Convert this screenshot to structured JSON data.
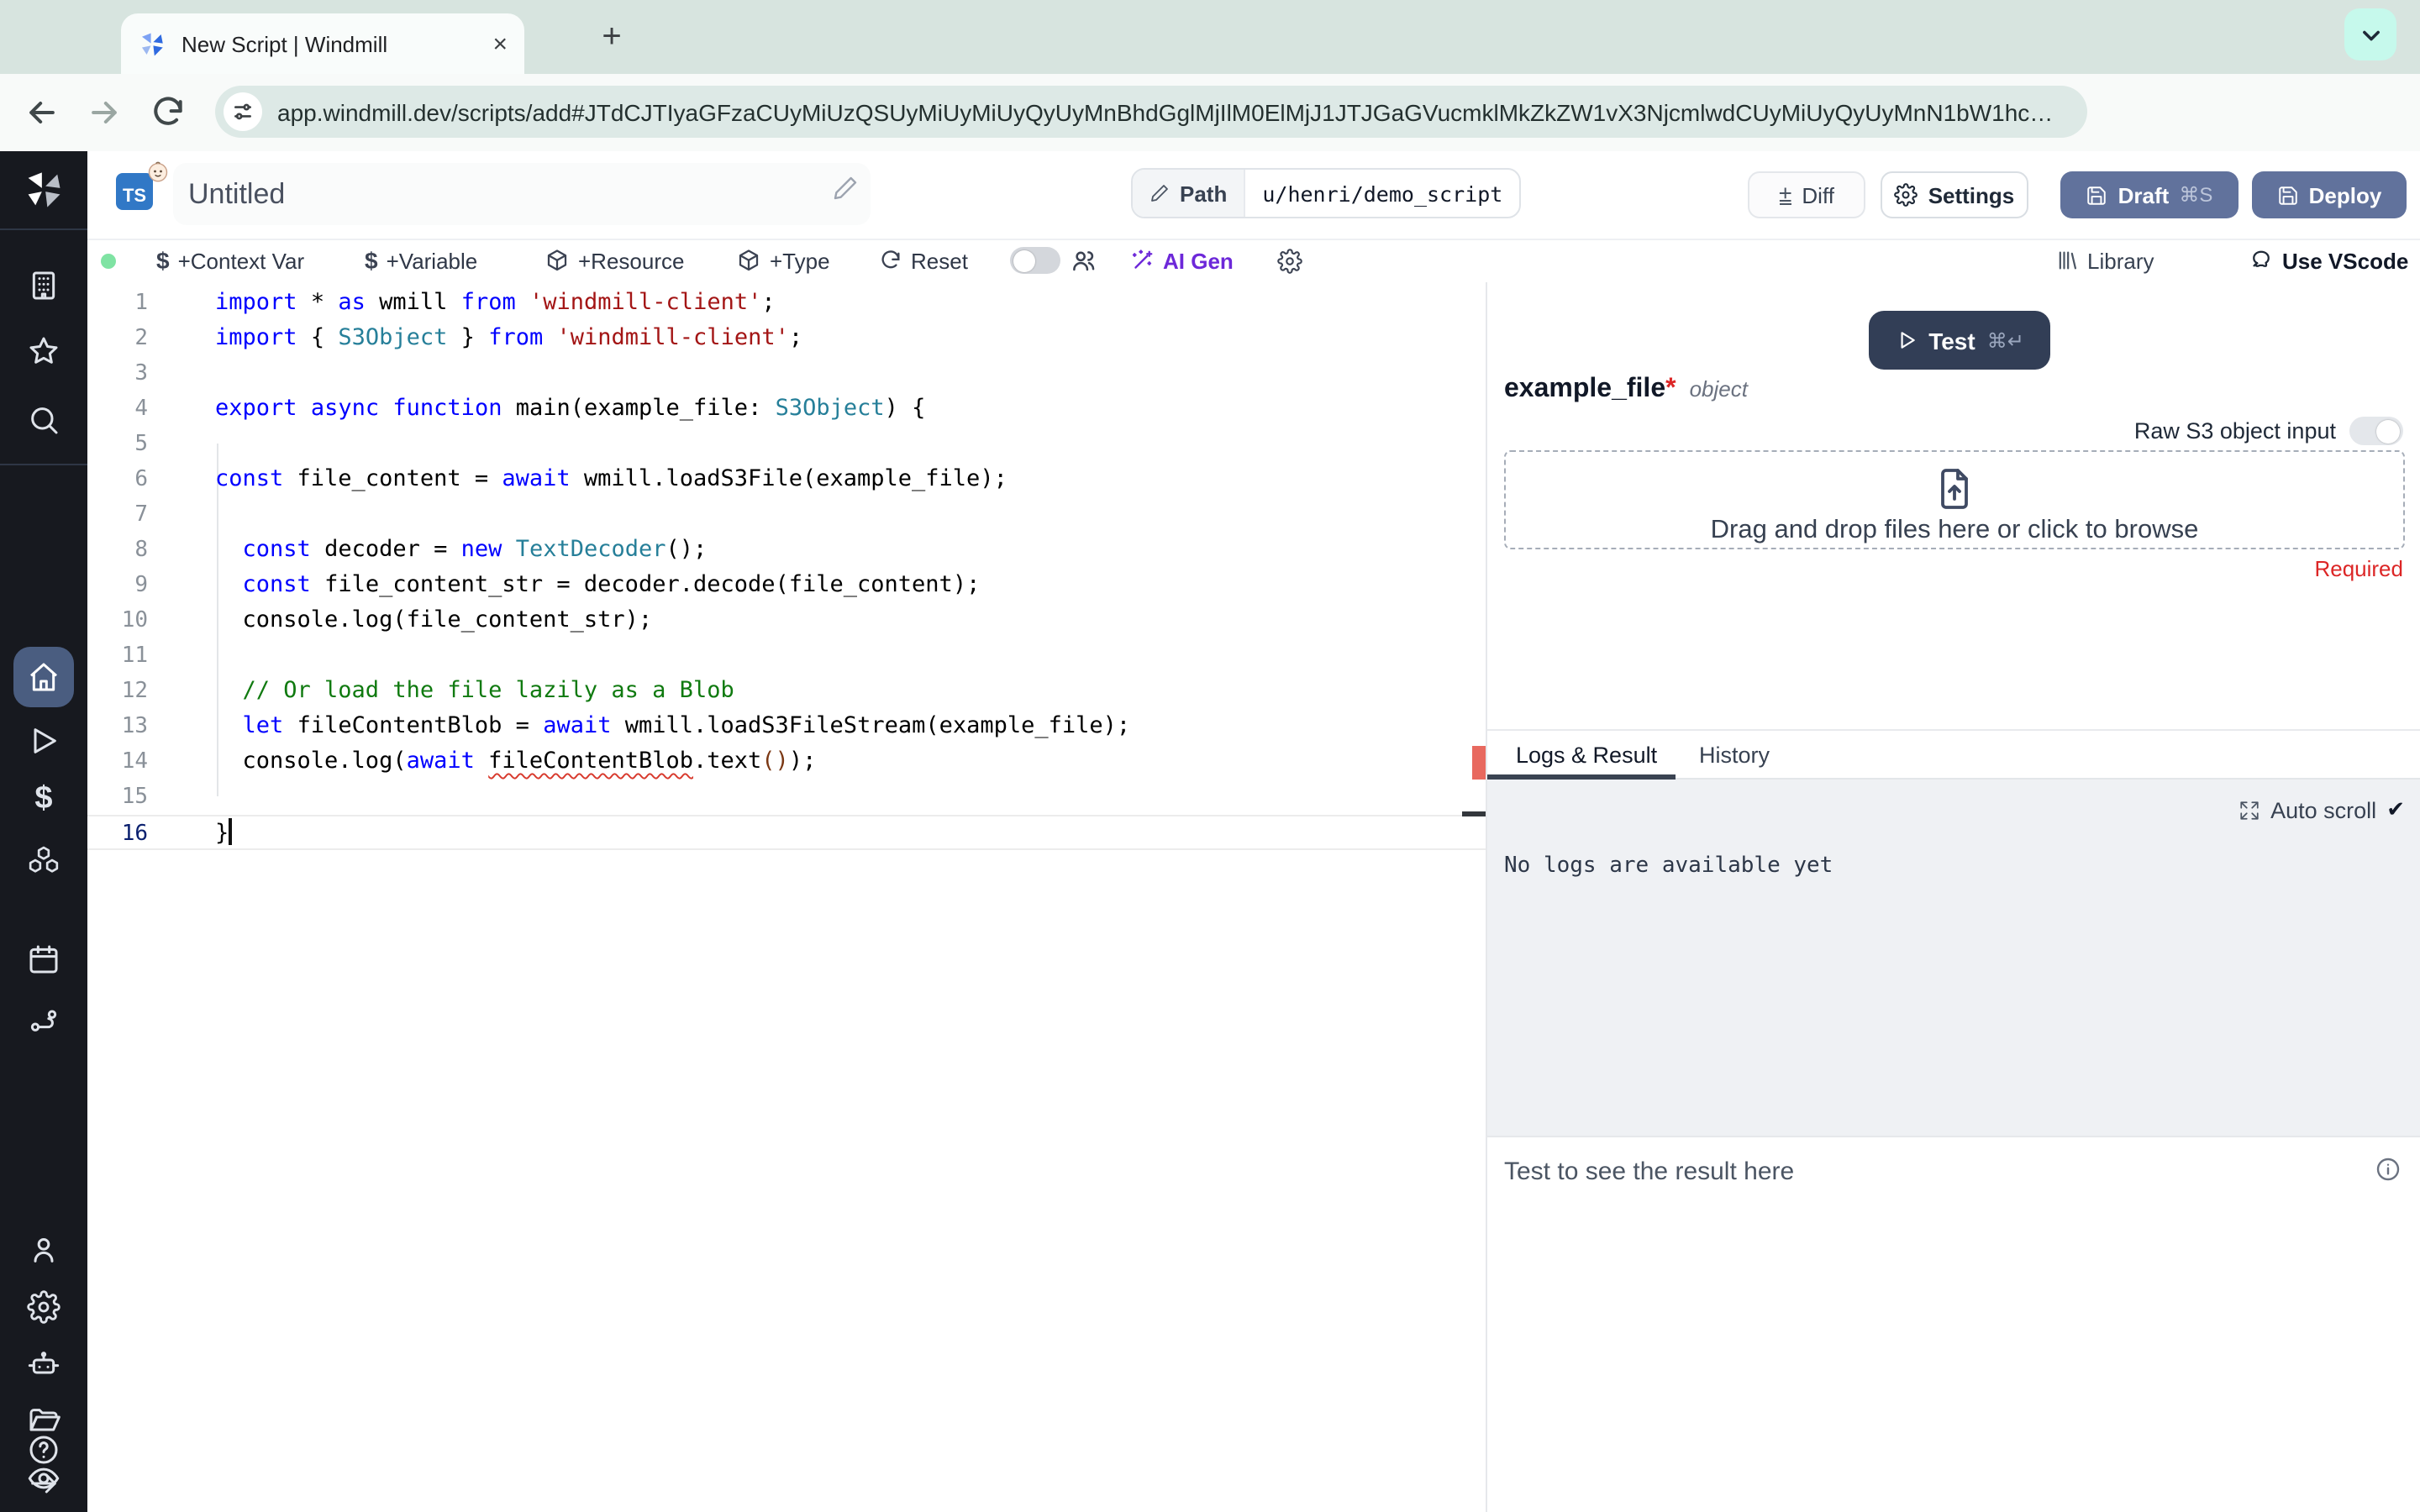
{
  "browser": {
    "tab_title": "New Script | Windmill",
    "url": "app.windmill.dev/scripts/add#JTdCJTIyaGFzaCUyMiUzQSUyMiUyMiUyQyUyMnBhdGglMjIlM0ElMjJ1JTJGaGVucmklMkZkZW1vX3NjcmlwdCUyMiUyQyUyMnN1bW1hc…",
    "close_tab": "×",
    "new_tab": "+"
  },
  "header": {
    "lang_badge": "TS",
    "title": "Untitled",
    "path_label": "Path",
    "path_value": "u/henri/demo_script",
    "diff_label": "Diff",
    "settings_label": "Settings",
    "draft_label": "Draft",
    "draft_kbd": "⌘S",
    "deploy_label": "Deploy"
  },
  "toolbar": {
    "context_var": "+Context Var",
    "variable": "+Variable",
    "resource": "+Resource",
    "type": "+Type",
    "reset": "Reset",
    "ai_gen": "AI Gen",
    "library": "Library",
    "use_vscode": "Use VScode",
    "dollar": "$"
  },
  "editor": {
    "active_line": 16,
    "lines": [
      [
        [
          "k",
          "import"
        ],
        [
          "p",
          " * "
        ],
        [
          "k",
          "as"
        ],
        [
          "p",
          " wmill "
        ],
        [
          "k",
          "from"
        ],
        [
          "p",
          " "
        ],
        [
          "s",
          "'windmill-client'"
        ],
        [
          "p",
          ";"
        ]
      ],
      [
        [
          "k",
          "import"
        ],
        [
          "p",
          " { "
        ],
        [
          "t",
          "S3Object"
        ],
        [
          "p",
          " } "
        ],
        [
          "k",
          "from"
        ],
        [
          "p",
          " "
        ],
        [
          "s",
          "'windmill-client'"
        ],
        [
          "p",
          ";"
        ]
      ],
      [],
      [
        [
          "k",
          "export"
        ],
        [
          "p",
          " "
        ],
        [
          "k",
          "async"
        ],
        [
          "p",
          " "
        ],
        [
          "k",
          "function"
        ],
        [
          "p",
          " main(example_file: "
        ],
        [
          "t",
          "S3Object"
        ],
        [
          "p",
          ") {"
        ]
      ],
      [],
      [
        [
          "k",
          "const"
        ],
        [
          "p",
          " file_content = "
        ],
        [
          "k",
          "await"
        ],
        [
          "p",
          " wmill.loadS3File(example_file);"
        ]
      ],
      [],
      [
        [
          "p",
          "  "
        ],
        [
          "k",
          "const"
        ],
        [
          "p",
          " decoder = "
        ],
        [
          "k",
          "new"
        ],
        [
          "p",
          " "
        ],
        [
          "t",
          "TextDecoder"
        ],
        [
          "p",
          "();"
        ]
      ],
      [
        [
          "p",
          "  "
        ],
        [
          "k",
          "const"
        ],
        [
          "p",
          " file_content_str = decoder.decode(file_content);"
        ]
      ],
      [
        [
          "p",
          "  console.log(file_content_str);"
        ]
      ],
      [],
      [
        [
          "c",
          "  // Or load the file lazily as a Blob"
        ]
      ],
      [
        [
          "p",
          "  "
        ],
        [
          "k",
          "let"
        ],
        [
          "p",
          " fileContentBlob = "
        ],
        [
          "k",
          "await"
        ],
        [
          "p",
          " wmill.loadS3FileStream(example_file);"
        ]
      ],
      [
        [
          "p",
          "  console.log("
        ],
        [
          "k",
          "await"
        ],
        [
          "p",
          " "
        ],
        [
          "e",
          "fileContentBlob"
        ],
        [
          "p",
          ".text"
        ],
        [
          "b",
          "()"
        ],
        [
          "p",
          ");"
        ]
      ],
      [],
      [
        [
          "p",
          "}"
        ]
      ]
    ]
  },
  "panel": {
    "test_label": "Test",
    "test_kbd": "⌘↵",
    "arg_name": "example_file",
    "arg_required_mark": "*",
    "arg_type": "object",
    "raw_s3_label": "Raw S3 object input",
    "dropzone_text": "Drag and drop files here or click to browse",
    "required_label": "Required",
    "tab_logs": "Logs & Result",
    "tab_history": "History",
    "auto_scroll_label": "Auto scroll",
    "auto_scroll_check": "✔",
    "no_logs_text": "No logs are available yet",
    "result_hint": "Test to see the result here"
  },
  "colors": {
    "chrome_bg": "#d7e4df",
    "mint_button": "#c6f9ec",
    "sidebar_bg": "#17191f",
    "sidebar_active": "#4a5d80",
    "primary_button": "#61729c",
    "test_button": "#323e56",
    "ai_gen_accent": "#6d28d9",
    "status_green": "#7fe3a3",
    "error_red": "#dc2626",
    "code_keyword": "#0000ff",
    "code_type": "#267f99",
    "code_string": "#a31515",
    "code_comment": "#107a10"
  }
}
